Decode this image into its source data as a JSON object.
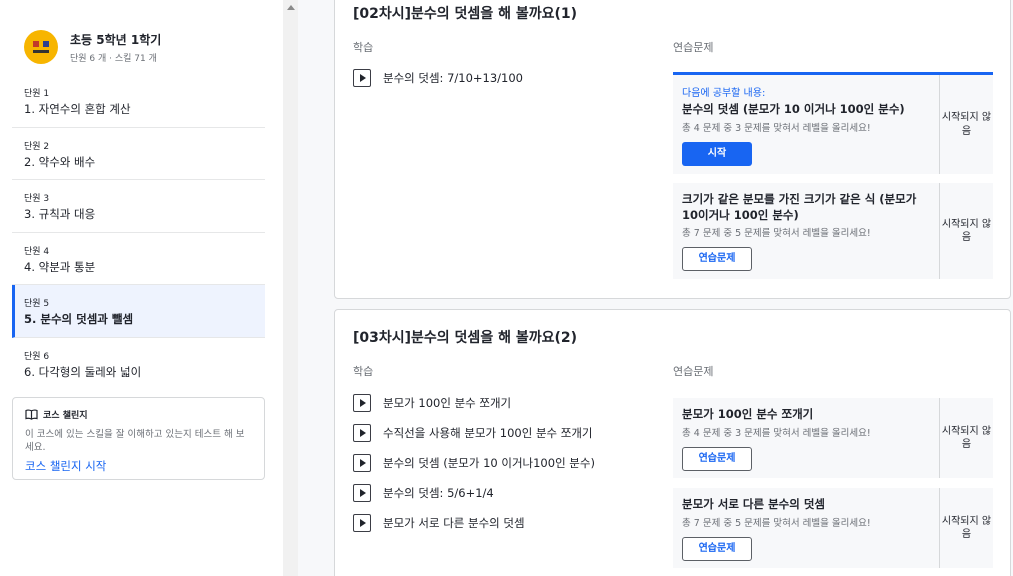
{
  "sidebar": {
    "course_title": "초등 5학년 1학기",
    "course_sub": "단원 6 개 · 스킬 71 개",
    "units": [
      {
        "label": "단원 1",
        "name": "1. 자연수의 혼합 계산"
      },
      {
        "label": "단원 2",
        "name": "2. 약수와 배수"
      },
      {
        "label": "단원 3",
        "name": "3. 규칙과 대응"
      },
      {
        "label": "단원 4",
        "name": "4. 약분과 통분"
      },
      {
        "label": "단원 5",
        "name": "5. 분수의 덧셈과 뺄셈"
      },
      {
        "label": "단원 6",
        "name": "6. 다각형의 둘레와 넓이"
      }
    ],
    "challenge": {
      "heading": "코스 챌린지",
      "desc": "이 코스에 있는 스킬을 잘 이해하고 있는지 테스트 해 보세요.",
      "link": "코스 챌린지 시작"
    }
  },
  "main": {
    "learn_header": "학습",
    "practice_header": "연습문제",
    "sections": [
      {
        "title": "[02차시]분수의 덧셈을 해 볼까요(1)",
        "videos": [
          "분수의 덧셈: 7/10+13/100"
        ],
        "exercises": [
          {
            "next_label": "다음에 공부할 내용:",
            "title": "분수의 덧셈 (분모가 10 이거나 100인 분수)",
            "sub": "총 4 문제 중 3 문제를 맞혀서 레벨을 올리세요!",
            "button": "시작",
            "status": "시작되지 않음"
          },
          {
            "title": "크기가 같은 분모를 가진 크기가 같은 식 (분모가 10이거나 100인 분수)",
            "sub": "총 7 문제 중 5 문제를 맞혀서 레벨을 올리세요!",
            "button": "연습문제",
            "status": "시작되지 않음"
          }
        ]
      },
      {
        "title": "[03차시]분수의 덧셈을 해 볼까요(2)",
        "videos": [
          "분모가 100인 분수 쪼개기",
          "수직선을 사용해 분모가 100인 분수 쪼개기",
          "분수의 덧셈 (분모가 10 이거나100인 분수)",
          "분수의 덧셈: 5/6+1/4",
          "분모가 서로 다른 분수의 덧셈"
        ],
        "exercises": [
          {
            "title": "분모가 100인 분수 쪼개기",
            "sub": "총 4 문제 중 3 문제를 맞혀서 레벨을 올리세요!",
            "button": "연습문제",
            "status": "시작되지 않음"
          },
          {
            "title": "분모가 서로 다른 분수의 덧셈",
            "sub": "총 7 문제 중 5 문제를 맞혀서 레벨을 올리세요!",
            "button": "연습문제",
            "status": "시작되지 않음"
          }
        ]
      }
    ]
  },
  "colors": {
    "accent": "#1865f2",
    "logo": "#f7b500"
  },
  "icons": {
    "challenge": "book-icon",
    "video": "play-icon"
  }
}
